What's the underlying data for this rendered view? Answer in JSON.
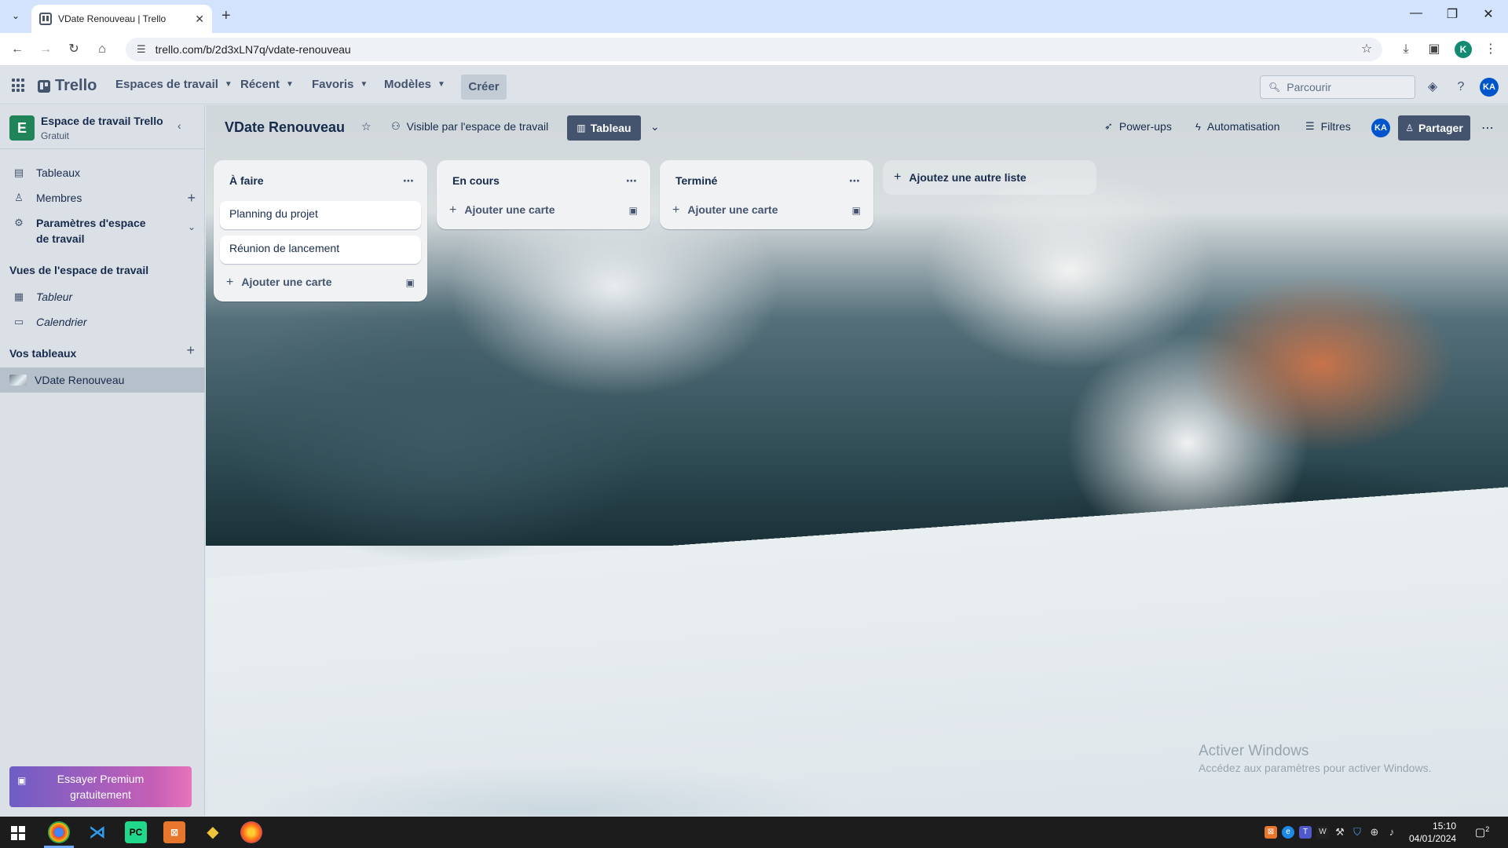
{
  "browser": {
    "tab_title": "VDate Renouveau | Trello",
    "new_tab": "+",
    "url": "trello.com/b/2d3xLN7q/vdate-renouveau",
    "profile_initial": "K",
    "window_controls": [
      "—",
      "❐",
      "✕"
    ]
  },
  "header": {
    "logo": "Trello",
    "menus": [
      {
        "label": "Espaces de travail"
      },
      {
        "label": "Récent"
      },
      {
        "label": "Favoris"
      },
      {
        "label": "Modèles"
      }
    ],
    "create": "Créer",
    "search_placeholder": "Parcourir",
    "avatar": "KA"
  },
  "sidebar": {
    "workspace_initial": "E",
    "workspace_name": "Espace de travail Trello",
    "workspace_plan": "Gratuit",
    "items": [
      {
        "label": "Tableaux",
        "icon": "board-icon"
      },
      {
        "label": "Membres",
        "icon": "person-icon"
      },
      {
        "label": "Paramètres d'espace de travail",
        "icon": "gear-icon"
      }
    ],
    "views_title": "Vues de l'espace de travail",
    "views": [
      {
        "label": "Tableur",
        "icon": "table-icon"
      },
      {
        "label": "Calendrier",
        "icon": "calendar-icon"
      }
    ],
    "boards_title": "Vos tableaux",
    "boards": [
      {
        "label": "VDate Renouveau"
      }
    ],
    "premium_line1": "Essayer Premium",
    "premium_line2": "gratuitement"
  },
  "board": {
    "title": "VDate Renouveau",
    "visibility": "Visible par l'espace de travail",
    "view": "Tableau",
    "powerups": "Power-ups",
    "automation": "Automatisation",
    "filters": "Filtres",
    "avatar": "KA",
    "share": "Partager",
    "lists": [
      {
        "title": "À faire",
        "cards": [
          "Planning du projet",
          "Réunion de lancement"
        ],
        "add": "Ajouter une carte"
      },
      {
        "title": "En cours",
        "cards": [],
        "add": "Ajouter une carte"
      },
      {
        "title": "Terminé",
        "cards": [],
        "add": "Ajouter une carte"
      }
    ],
    "add_list": "Ajoutez une autre liste"
  },
  "watermark": {
    "line1": "Activer Windows",
    "line2": "Accédez aux paramètres pour activer Windows."
  },
  "taskbar": {
    "time": "15:10",
    "date": "04/01/2024",
    "notification_count": "2"
  }
}
